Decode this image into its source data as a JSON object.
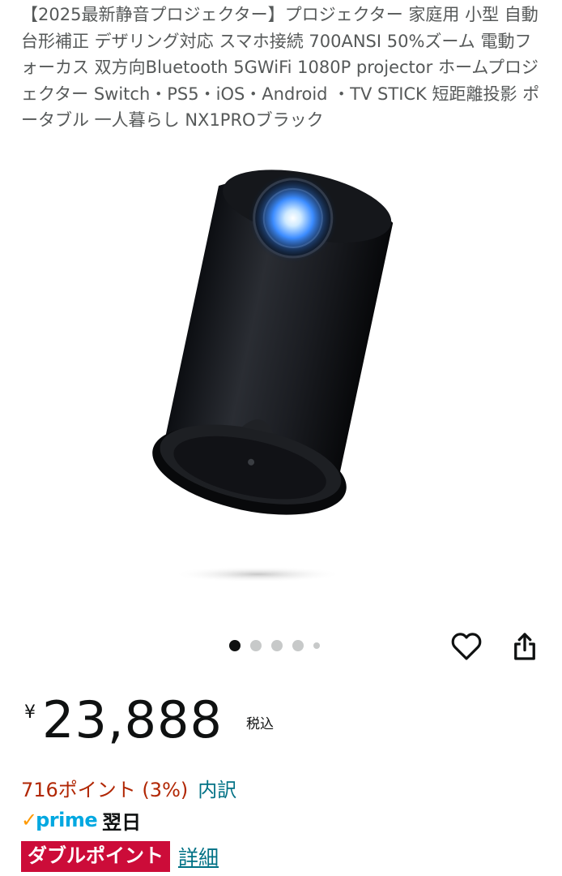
{
  "product": {
    "title": "【2025最新静音プロジェクター】プロジェクター 家庭用 小型 自動台形補正 デザリング対応 スマホ接続 700ANSI 50%ズーム 電動フォーカス 双方向Bluetooth 5GWiFi 1080P projector ホームプロジェクター Switch・PS5・iOS・Android ・TV STICK 短距離投影 ポータブル 一人暮らし NX1PROブラック"
  },
  "carousel": {
    "total_dots": 5,
    "active_index": 0
  },
  "actions": {
    "wishlist_icon": "heart-outline-icon",
    "share_icon": "share-icon"
  },
  "price": {
    "currency": "¥",
    "amount": "23,888",
    "tax_label": "税込"
  },
  "points": {
    "text": "716ポイント (3%)",
    "breakdown_link": "内訳"
  },
  "prime": {
    "check": "✓",
    "label": "prime",
    "delivery": "翌日"
  },
  "promo": {
    "badge": "ダブルポイント",
    "details_link": "詳細"
  },
  "colors": {
    "price_red": "#b12704",
    "link_teal": "#007185",
    "badge_red": "#cc0c39",
    "prime_blue": "#00a8e1",
    "prime_orange": "#ff9900"
  }
}
